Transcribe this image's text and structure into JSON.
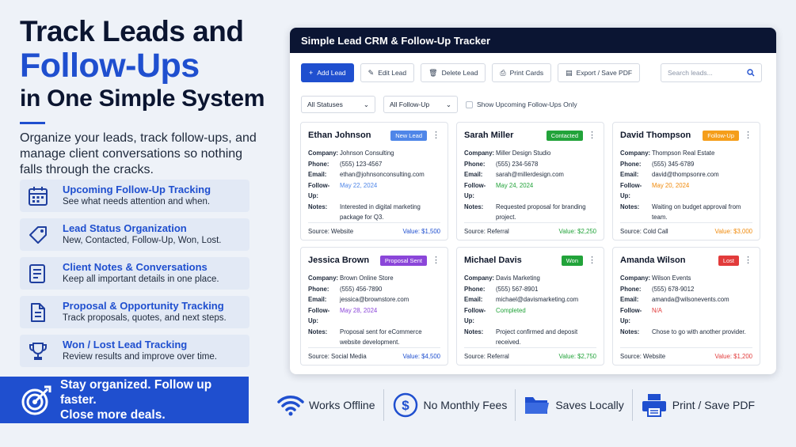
{
  "hero": {
    "line1": "Track Leads and",
    "line2": "Follow-Ups",
    "line3": "in One Simple System",
    "description": "Organize your leads, track follow-ups, and manage client conversations so nothing falls through the cracks."
  },
  "features": [
    {
      "title": "Upcoming Follow-Up Tracking",
      "subtitle": "See what needs attention and when.",
      "icon": "calendar-icon"
    },
    {
      "title": "Lead Status Organization",
      "subtitle": "New, Contacted, Follow-Up, Won, Lost.",
      "icon": "tag-icon"
    },
    {
      "title": "Client Notes & Conversations",
      "subtitle": "Keep all important details in one place.",
      "icon": "notes-icon"
    },
    {
      "title": "Proposal & Opportunity Tracking",
      "subtitle": "Track proposals, quotes, and next steps.",
      "icon": "document-icon"
    },
    {
      "title": "Won / Lost Lead Tracking",
      "subtitle": "Review results and improve over time.",
      "icon": "trophy-icon"
    }
  ],
  "cta": {
    "line1": "Stay organized. Follow up faster.",
    "line2": "Close more deals."
  },
  "app": {
    "title": "Simple Lead CRM & Follow-Up Tracker",
    "toolbar": {
      "add": "Add Lead",
      "edit": "Edit Lead",
      "delete": "Delete Lead",
      "print": "Print Cards",
      "export": "Export / Save PDF",
      "search_placeholder": "Search leads..."
    },
    "filters": {
      "status": "All Statuses",
      "followup": "All Follow-Up",
      "upcoming_only": "Show Upcoming Follow-Ups Only"
    },
    "labels": {
      "company": "Company:",
      "phone": "Phone:",
      "email": "Email:",
      "followup": "Follow-Up:",
      "notes": "Notes:"
    },
    "leads": [
      {
        "name": "Ethan Johnson",
        "status": "New Lead",
        "status_color": "#4f86e8",
        "company": "Johnson Consulting",
        "phone": "(555) 123-4567",
        "email": "ethan@johnsonconsulting.com",
        "followup": "May 22, 2024",
        "followup_color": "#4f86e8",
        "notes": "Interested in digital marketing package for Q3.",
        "source": "Source: Website",
        "value": "Value: $1,500",
        "value_color": "#1f4fcf"
      },
      {
        "name": "Sarah Miller",
        "status": "Contacted",
        "status_color": "#22a33a",
        "company": "Miller Design Studio",
        "phone": "(555) 234-5678",
        "email": "sarah@millerdesign.com",
        "followup": "May 24, 2024",
        "followup_color": "#22a33a",
        "notes": "Requested proposal for branding project.",
        "source": "Source: Referral",
        "value": "Value: $2,250",
        "value_color": "#22a33a"
      },
      {
        "name": "David Thompson",
        "status": "Follow-Up",
        "status_color": "#f59e1b",
        "company": "Thompson Real Estate",
        "phone": "(555) 345-6789",
        "email": "david@thompsonre.com",
        "followup": "May 20, 2024",
        "followup_color": "#f08a0b",
        "notes": "Waiting on budget approval from team.",
        "source": "Source: Cold Call",
        "value": "Value: $3,000",
        "value_color": "#f08a0b"
      },
      {
        "name": "Jessica Brown",
        "status": "Proposal Sent",
        "status_color": "#8b46d9",
        "company": "Brown Online Store",
        "phone": "(555) 456-7890",
        "email": "jessica@brownstore.com",
        "followup": "May 28, 2024",
        "followup_color": "#8b46d9",
        "notes": "Proposal sent for eCommerce website development.",
        "source": "Source: Social Media",
        "value": "Value: $4,500",
        "value_color": "#1f4fcf"
      },
      {
        "name": "Michael Davis",
        "status": "Won",
        "status_color": "#22a33a",
        "company": "Davis Marketing",
        "phone": "(555) 567-8901",
        "email": "michael@davismarketing.com",
        "followup": "Completed",
        "followup_color": "#22a33a",
        "notes": "Project confirmed and deposit received.",
        "source": "Source: Referral",
        "value": "Value: $2,750",
        "value_color": "#22a33a"
      },
      {
        "name": "Amanda Wilson",
        "status": "Lost",
        "status_color": "#e23b3b",
        "company": "Wilson Events",
        "phone": "(555) 678-9012",
        "email": "amanda@wilsonevents.com",
        "followup": "N/A",
        "followup_color": "#e23b3b",
        "notes": "Chose to go with another provider.",
        "source": "Source: Website",
        "value": "Value: $1,200",
        "value_color": "#e23b3b"
      }
    ]
  },
  "benefits": [
    {
      "label": "Works Offline",
      "icon": "wifi-icon"
    },
    {
      "label": "No Monthly Fees",
      "icon": "dollar-icon"
    },
    {
      "label": "Saves Locally",
      "icon": "folder-icon"
    },
    {
      "label": "Print / Save PDF",
      "icon": "printer-icon"
    }
  ],
  "colors": {
    "brand": "#1f4fcf",
    "dark": "#0b1533"
  }
}
